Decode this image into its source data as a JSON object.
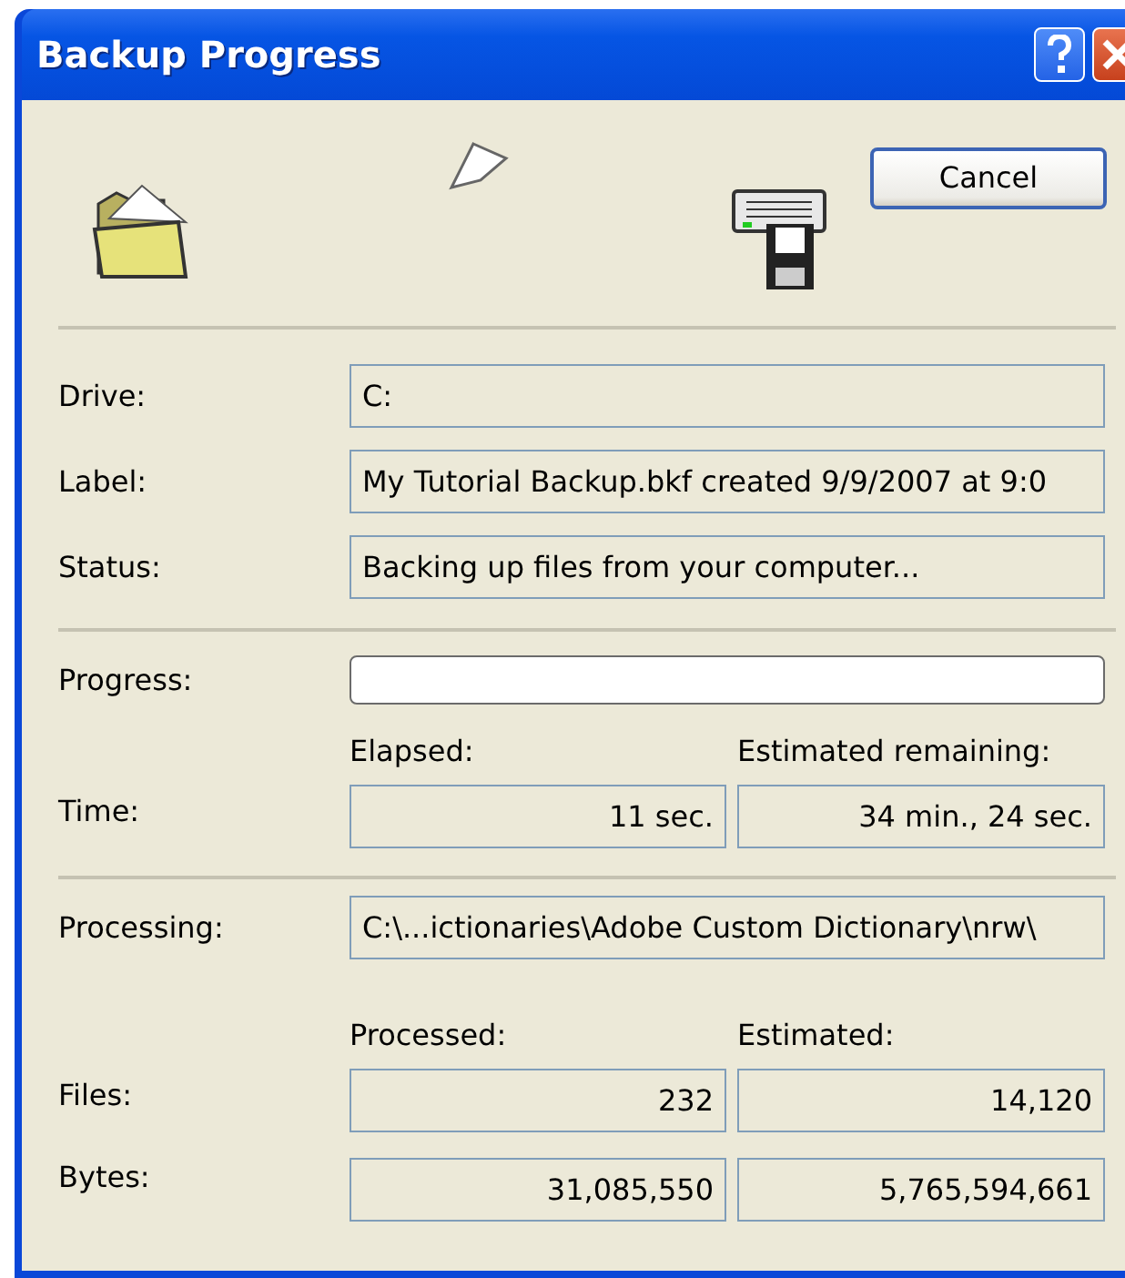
{
  "window": {
    "title": "Backup Progress"
  },
  "title_buttons": [
    {
      "kind": "help"
    },
    {
      "kind": "close"
    }
  ],
  "cancel_button": "Cancel",
  "fields": [
    {
      "label": "Drive:",
      "value": "C:"
    },
    {
      "label": "Label:",
      "value": "My Tutorial Backup.bkf created 9/9/2007 at 9:0"
    },
    {
      "label": "Status:",
      "value": "Backing up files from your computer..."
    }
  ],
  "progress": {
    "label": "Progress:",
    "level": 0
  },
  "time": {
    "label": "Time:",
    "headers": [
      "Elapsed:",
      "Estimated remaining:"
    ],
    "values": [
      "11 sec.",
      "34 min., 24 sec."
    ]
  },
  "processing": {
    "label": "Processing:",
    "value": "C:\\...ictionaries\\Adobe Custom Dictionary\\nrw\\"
  },
  "counts": {
    "headers": [
      "Processed:",
      "Estimated:"
    ],
    "rows": [
      {
        "label": "Files:",
        "values": [
          "232",
          "14,120"
        ]
      },
      {
        "label": "Bytes:",
        "values": [
          "31,085,550",
          "5,765,594,661"
        ]
      }
    ]
  }
}
